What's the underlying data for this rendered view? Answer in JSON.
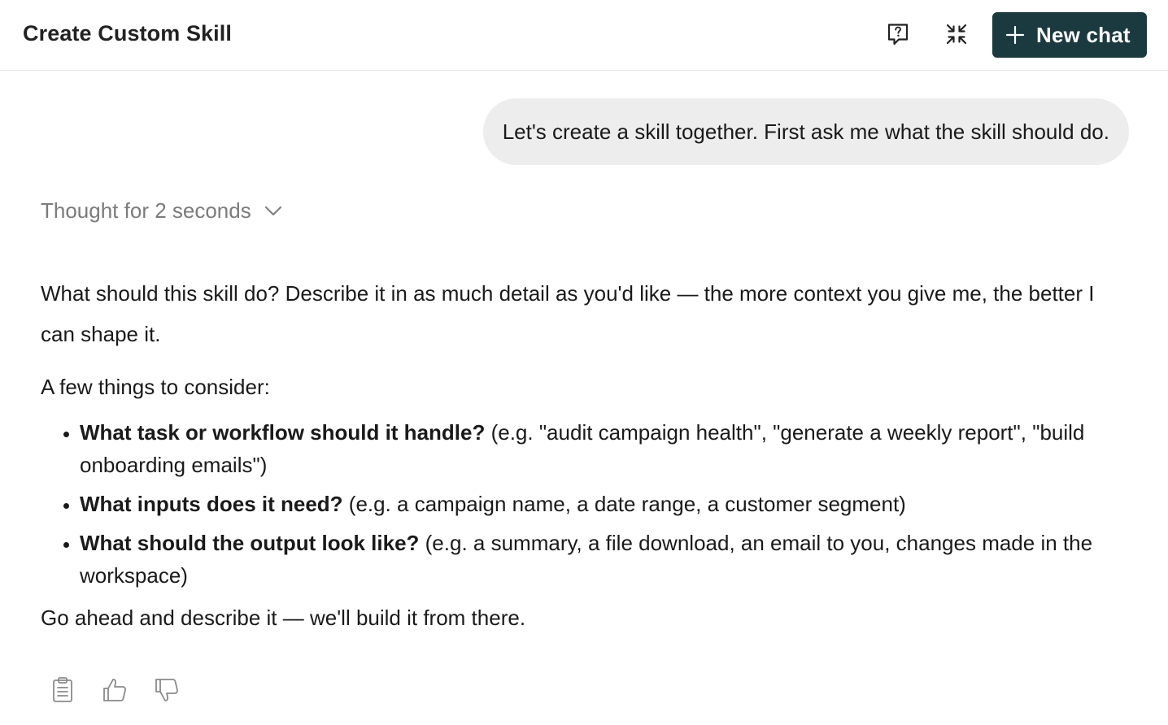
{
  "header": {
    "title": "Create Custom Skill",
    "new_chat_label": "New chat",
    "accent_color": "#1b3a3f"
  },
  "icons": {
    "feedback": "feedback-question-icon",
    "collapse": "collapse-icon",
    "plus": "plus-icon",
    "chevron": "chevron-down-icon",
    "copy": "clipboard-copy-icon",
    "thumbs_up": "thumbs-up-icon",
    "thumbs_down": "thumbs-down-icon"
  },
  "chat": {
    "user_message": "Let's create a skill together. First ask me what the skill should do.",
    "thought_label": "Thought for 2 seconds",
    "answer": {
      "intro": "What should this skill do? Describe it in as much detail as you'd like — the more context you give me, the better I can shape it.",
      "consider": "A few things to consider:",
      "bullets": [
        {
          "bold": "What task or workflow should it handle?",
          "rest": " (e.g. \"audit campaign health\", \"generate a weekly report\", \"build onboarding emails\")"
        },
        {
          "bold": "What inputs does it need?",
          "rest": " (e.g. a campaign name, a date range, a customer segment)"
        },
        {
          "bold": "What should the output look like?",
          "rest": " (e.g. a summary, a file download, an email to you, changes made in the workspace)"
        }
      ],
      "closing": "Go ahead and describe it — we'll build it from there."
    }
  }
}
